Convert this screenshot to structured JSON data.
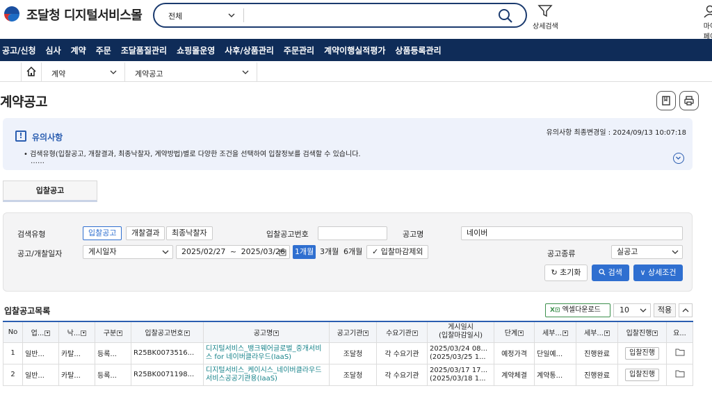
{
  "header": {
    "logo_text": "조달청 디지털서비스몰",
    "search_scope": "전체",
    "search_placeholder": "",
    "detail_search_label": "상세검색",
    "mypage_label": "마이페이"
  },
  "gnb": [
    "공고/신청",
    "심사",
    "계약",
    "주문",
    "조달품질관리",
    "쇼핑몰운영",
    "사후/상품관리",
    "주문관리",
    "계약이행실적평가",
    "상품등록관리"
  ],
  "breadcrumb": {
    "level1": "계약",
    "level2": "계약공고"
  },
  "page_title": "계약공고",
  "notice": {
    "title": "유의사항",
    "last_modified": "유의사항 최종변경일 : 2024/09/13 10:07:18",
    "text": "• 검색유형(입찰공고, 개찰결과, 최종낙찰자, 계약방법)별로 다양한 조건을 선택하여 입찰정보를 검색할 수 있습니다.",
    "more": "……"
  },
  "tab": "입찰공고",
  "search_panel": {
    "type_label": "검색유형",
    "types": [
      "입찰공고",
      "개찰결과",
      "최종낙찰자"
    ],
    "notice_no_label": "입찰공고번호",
    "notice_no_value": "",
    "notice_name_label": "공고명",
    "notice_name_value": "네이버",
    "date_label": "공고/개찰일자",
    "date_type": "게시일자",
    "date_from": "2025/02/27",
    "date_sep": "~",
    "date_to": "2025/03/26",
    "periods": [
      "1개월",
      "3개월",
      "6개월"
    ],
    "exclude_closed": "입찰마감제외",
    "kind_label": "공고종류",
    "kind_value": "실공고",
    "reset": "초기화",
    "search": "검색",
    "detail": "상세조건"
  },
  "list": {
    "title": "입찰공고목록",
    "excel": "엑셀다운로드",
    "per_page": "10",
    "apply": "적용",
    "columns": [
      "No",
      "업...",
      "낙...",
      "구분",
      "입찰공고번호",
      "공고명",
      "공고기관",
      "수요기관",
      "게시일시\n(입찰마감일시)",
      "단계",
      "세부...",
      "세부...",
      "입찰진행",
      "요..."
    ],
    "rows": [
      {
        "no": "1",
        "c1": "일반...",
        "c2": "카탈...",
        "c3": "등록...",
        "num": "R25BK0073516...",
        "name": "디지털서비스_뱅크웨어글로벌_중개서비스 for 네이버클라우드(IaaS)",
        "agency": "조달청",
        "demand": "각 수요기관",
        "date1": "2025/03/24 08...",
        "date2": "(2025/03/25 1...",
        "stage": "예정가격",
        "detail1": "단일예...",
        "detail2": "진행완료",
        "btn": "입찰진행"
      },
      {
        "no": "2",
        "c1": "일반...",
        "c2": "카탈...",
        "c3": "등록...",
        "num": "R25BK0071198...",
        "name": "디지털서비스_케이시스_네이버클라우드서비스공공기관용(IaaS)",
        "agency": "조달청",
        "demand": "각 수요기관",
        "date1": "2025/03/17 17...",
        "date2": "(2025/03/18 1...",
        "stage": "계약체결",
        "detail1": "계약통...",
        "detail2": "진행완료",
        "btn": "입찰진행"
      }
    ]
  },
  "colors": {
    "navy": "#0f2c58",
    "blue": "#2f6fd0",
    "link": "#17838a"
  }
}
